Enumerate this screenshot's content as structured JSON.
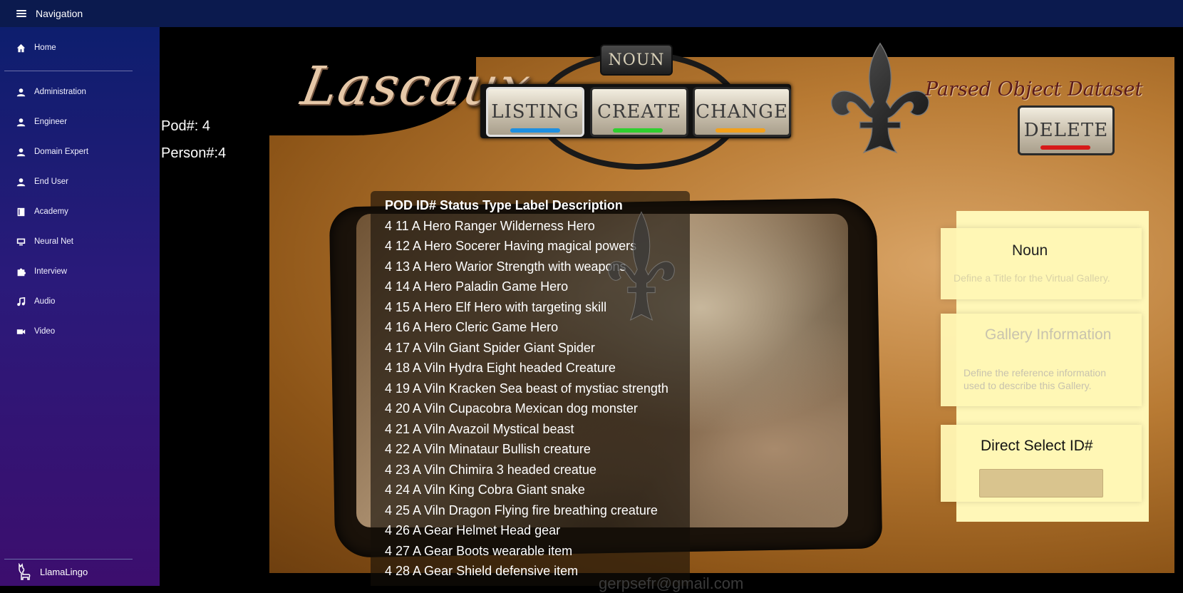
{
  "topbar": {
    "title": "Navigation"
  },
  "sidebar": {
    "items": [
      {
        "label": "Home",
        "icon": "home-icon"
      },
      {
        "label": "Administration",
        "icon": "person-icon"
      },
      {
        "label": "Engineer",
        "icon": "person-icon"
      },
      {
        "label": "Domain Expert",
        "icon": "person-icon"
      },
      {
        "label": "End User",
        "icon": "person-icon"
      },
      {
        "label": "Academy",
        "icon": "book-icon"
      },
      {
        "label": "Neural Net",
        "icon": "monitor-icon"
      },
      {
        "label": "Interview",
        "icon": "puzzle-icon"
      },
      {
        "label": "Audio",
        "icon": "music-icon"
      },
      {
        "label": "Video",
        "icon": "video-icon"
      }
    ],
    "footer": {
      "label": "LlamaLingo",
      "icon": "llama-icon"
    }
  },
  "info": {
    "pod": "Pod#: 4",
    "person": "Person#:4"
  },
  "brand": {
    "logo": "Lascaux",
    "heading": "Parsed Object Dataset"
  },
  "buttons": {
    "noun": "NOUN",
    "listing": "LISTING",
    "create": "CREATE",
    "change": "CHANGE",
    "delete": "DELETE",
    "colors": {
      "listing": "#1e8fe0",
      "create": "#2fcf2f",
      "change": "#f2a01c",
      "delete": "#d61a1a"
    }
  },
  "listing": {
    "header": "POD ID# Status Type Label Description",
    "rows": [
      "4 11 A Hero Ranger Wilderness Hero",
      "4 12 A Hero Socerer Having magical powers",
      "4 13 A Hero Warior Strength with weapons",
      "4 14 A Hero Paladin Game Hero",
      "4 15 A Hero Elf Hero with targeting skill",
      "4 16 A Hero Cleric Game Hero",
      "4 17 A Viln Giant Spider Giant Spider",
      "4 18 A Viln Hydra Eight headed Creature",
      "4 19 A Viln Kracken Sea beast of mystiac strength",
      "4 20 A Viln Cupacobra Mexican dog monster",
      "4 21 A Viln Avazoil Mystical beast",
      "4 22 A Viln Minataur Bullish creature",
      "4 23 A Viln Chimira 3 headed creatue",
      "4 24 A Viln King Cobra Giant snake",
      "4 25 A Viln Dragon Flying fire breathing creature",
      "4 26 A Gear Helmet Head gear",
      "4 27 A Gear Boots wearable item",
      "4 28 A Gear Shield defensive item"
    ]
  },
  "cards": {
    "noun": {
      "title": "Noun",
      "placeholder": "Define a Title for the Virtual Gallery."
    },
    "gallery": {
      "title": "Gallery Information",
      "text": "Define the reference information used to describe this Gallery."
    },
    "direct": {
      "title": "Direct Select  ID#",
      "value": ""
    }
  },
  "footer": {
    "email": "gerpsefr@gmail.com"
  }
}
